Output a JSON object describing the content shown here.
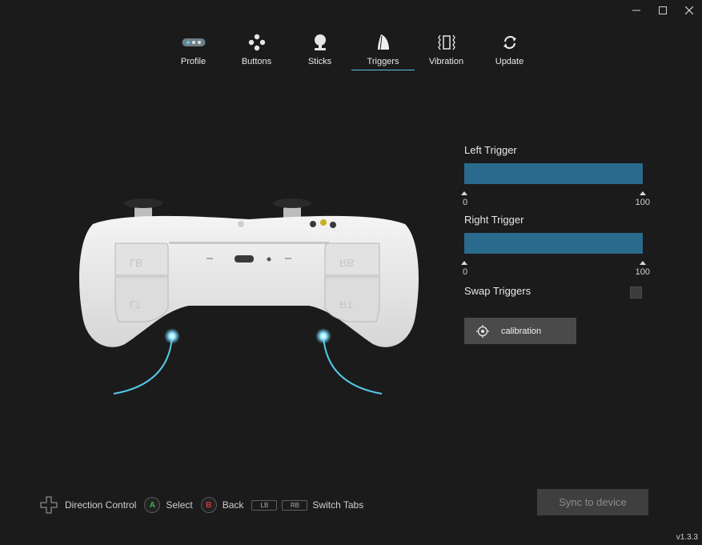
{
  "window": {
    "controls": [
      {
        "name": "minimize-icon"
      },
      {
        "name": "maximize-icon"
      },
      {
        "name": "close-icon"
      }
    ]
  },
  "tabs": [
    {
      "label": "Profile",
      "icon": "profile-icon",
      "active": false
    },
    {
      "label": "Buttons",
      "icon": "buttons-icon",
      "active": false
    },
    {
      "label": "Sticks",
      "icon": "joystick-icon",
      "active": false
    },
    {
      "label": "Triggers",
      "icon": "trigger-icon",
      "active": true
    },
    {
      "label": "Vibration",
      "icon": "vibration-icon",
      "active": false
    },
    {
      "label": "Update",
      "icon": "refresh-icon",
      "active": false
    }
  ],
  "controller": {
    "left_labels": [
      "LB",
      "LT"
    ],
    "right_labels": [
      "RB",
      "RT"
    ]
  },
  "triggers": {
    "left": {
      "title": "Left Trigger",
      "min": "0",
      "max": "100"
    },
    "right": {
      "title": "Right Trigger",
      "min": "0",
      "max": "100"
    },
    "swap_label": "Swap Triggers",
    "swap_checked": false,
    "calibration_label": "calibration"
  },
  "legend": {
    "direction": "Direction Control",
    "select_key": "A",
    "select": "Select",
    "back_key": "B",
    "back": "Back",
    "lb": "LB",
    "rb": "RB",
    "switch": "Switch Tabs"
  },
  "sync_label": "Sync to device",
  "version": "v1.3.3",
  "colors": {
    "background": "#1b1b1b",
    "accent": "#55c7e8",
    "bar": "#2a6a8c",
    "select_green": "#3dbb4a",
    "back_red": "#d0343a"
  }
}
